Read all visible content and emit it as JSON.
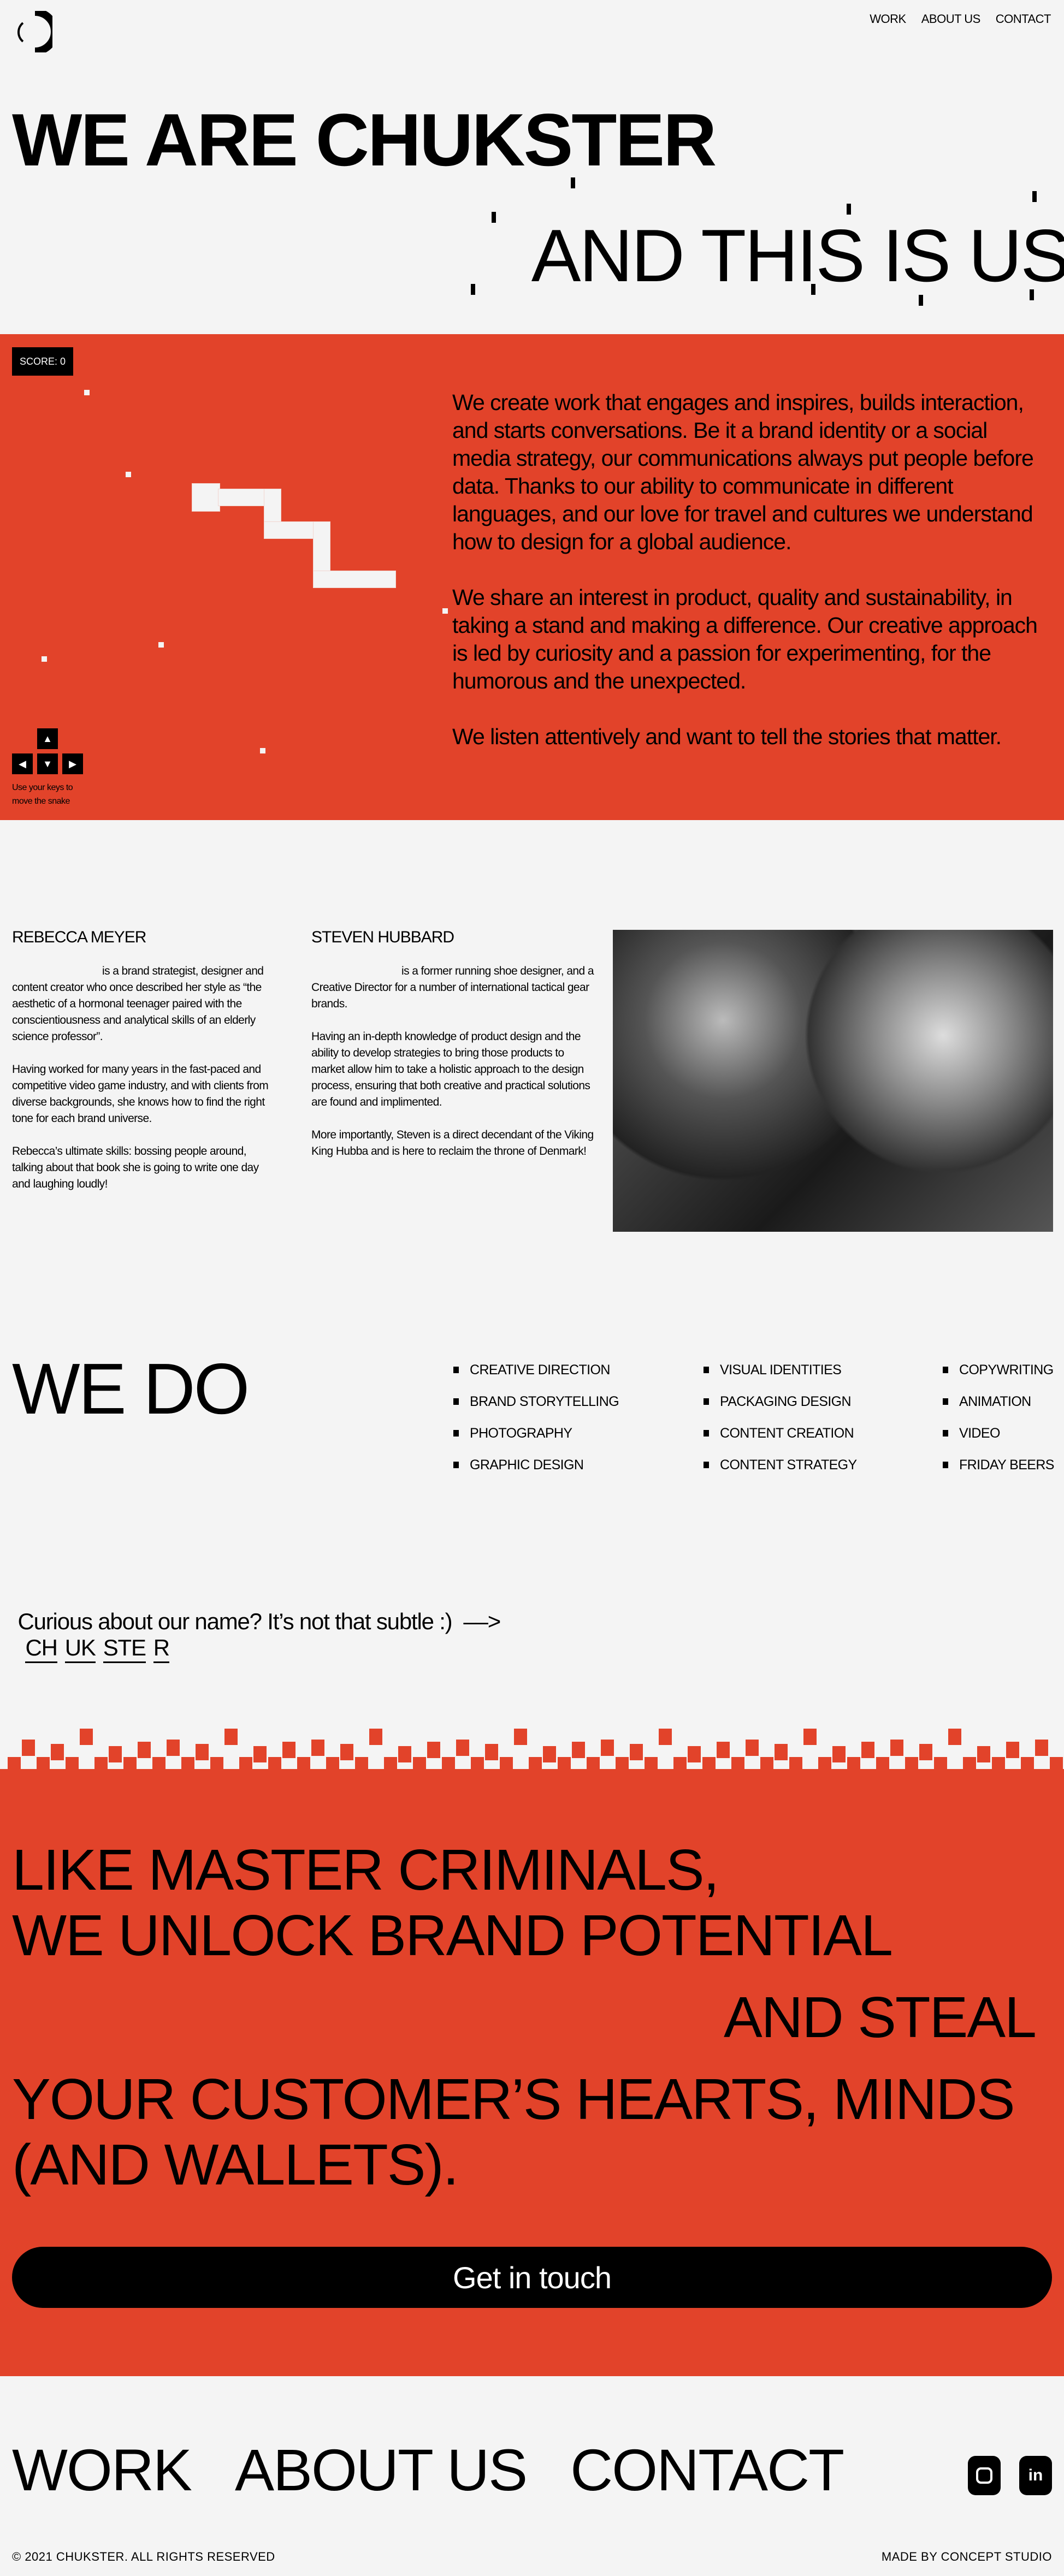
{
  "colors": {
    "accent": "#e2432a",
    "background": "#f4f4f4",
    "text": "#000000"
  },
  "header": {
    "logo_icon": "chukster-c-logo",
    "nav": [
      "WORK",
      "ABOUT US",
      "CONTACT"
    ]
  },
  "hero": {
    "line1": "WE ARE CHUKSTER",
    "line2": "AND THIS IS US"
  },
  "game": {
    "score": "SCORE: 0",
    "hint": "Use your keys to move the snake",
    "keys": [
      "up-arrow-icon",
      "left-arrow-icon",
      "down-arrow-icon",
      "right-arrow-icon"
    ]
  },
  "intro": {
    "paragraphs": [
      "We create work that engages and inspires, builds interaction, and starts conversations. Be it a brand identity or a social media strategy, our communications always put people before data. Thanks to our ability to communicate in different languages, and our love for travel and cultures we understand how to design for a global audience.",
      "We share an interest in product, quality and sustainability, in taking a stand and making a difference. Our creative approach is led by curiosity and a passion for experimenting, for the humorous and the unexpected.",
      "We listen attentively and want to tell the stories that matter."
    ]
  },
  "team": [
    {
      "name": "REBECCA MEYER",
      "paragraphs": [
        "is a brand strategist, designer and content creator who once described her style as “the aesthetic of a hormonal teenager paired with the conscientiousness and analytical skills of an elderly science professor”.",
        "Having worked for many years in the fast-paced and competitive video game industry, and with clients from diverse backgrounds, she knows how to find the right tone for each brand universe.",
        "Rebecca’s ultimate skills: bossing people around, talking about that book she is going to write one day and laughing loudly!"
      ]
    },
    {
      "name": "STEVEN HUBBARD",
      "paragraphs": [
        "is a former running shoe designer, and a Creative Director for a number of international tactical gear brands.",
        "Having an in-depth knowledge of product design and the ability to develop strategies to bring those products to market allow him to take a holistic approach to the design process, ensuring that both creative and practical solutions are found and implimented.",
        "More importantly, Steven is a direct decendant of the Viking King Hubba and is here to reclaim the throne of Denmark!"
      ]
    }
  ],
  "services": {
    "title": "WE DO",
    "columns": [
      [
        "CREATIVE DIRECTION",
        "BRAND STORYTELLING",
        "PHOTOGRAPHY",
        "GRAPHIC DESIGN"
      ],
      [
        "VISUAL IDENTITIES",
        "PACKAGING DESIGN",
        "CONTENT CREATION",
        "CONTENT STRATEGY"
      ],
      [
        "COPYWRITING",
        "ANIMATION",
        "VIDEO",
        "FRIDAY BEERS"
      ]
    ]
  },
  "name_line": {
    "text": "Curious about our name? It’s not that subtle :)  ––>",
    "parts": [
      "CH",
      "UK",
      "STE",
      "R"
    ]
  },
  "manifesto": {
    "line1": "LIKE MASTER CRIMINALS,",
    "line2": "WE UNLOCK BRAND POTENTIAL",
    "line3": "AND STEAL",
    "line4": "YOUR CUSTOMER’S HEARTS, MINDS",
    "line5": "(AND WALLETS).",
    "cta": "Get in touch"
  },
  "footer": {
    "nav": [
      "WORK",
      "ABOUT US",
      "CONTACT"
    ],
    "social": [
      "instagram-icon",
      "linkedin-icon"
    ],
    "copyright": "© 2021 CHUKSTER. ALL RIGHTS RESERVED",
    "credit": "MADE BY CONCEPT STUDIO"
  }
}
